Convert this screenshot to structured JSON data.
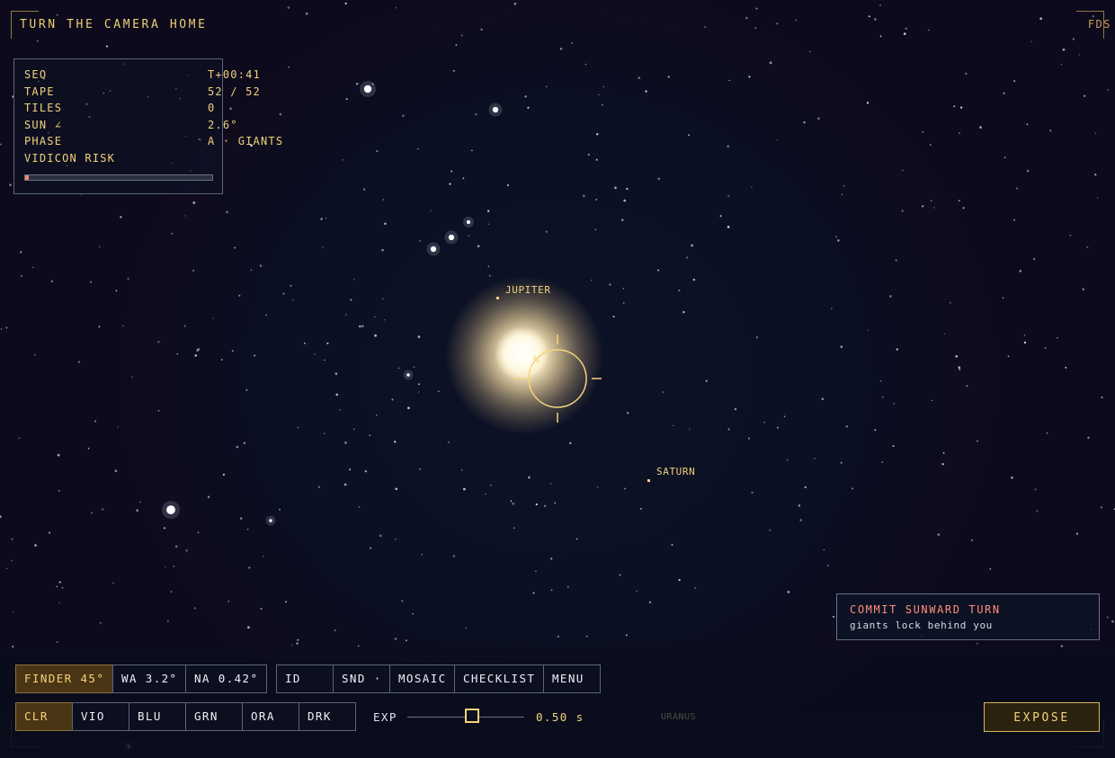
{
  "mission": {
    "title": "TURN THE CAMERA HOME",
    "fds_label": "FDS"
  },
  "status": {
    "seq_label": "SEQ",
    "seq_value": "T+00:41",
    "tape_label": "TAPE",
    "tape_value": "52 / 52",
    "tiles_label": "TILES",
    "tiles_value": "0",
    "sun_label": "SUN ∠",
    "sun_value": "2.6°",
    "phase_label": "PHASE",
    "phase_value": "A · GIANTS",
    "risk_label": "VIDICON RISK",
    "risk_fraction": 0.02
  },
  "targets": {
    "jupiter": "JUPITER",
    "saturn": "SATURN",
    "uranus": "URANUS"
  },
  "alert": {
    "title": "COMMIT SUNWARD TURN",
    "subtitle": "giants lock behind you"
  },
  "camera_modes": [
    {
      "label": "FINDER 45°",
      "active": true
    },
    {
      "label": "WA 3.2°",
      "active": false
    },
    {
      "label": "NA 0.42°",
      "active": false
    }
  ],
  "tools": [
    {
      "label": "ID"
    },
    {
      "label": "SND ·"
    },
    {
      "label": "MOSAIC"
    },
    {
      "label": "CHECKLIST"
    },
    {
      "label": "MENU"
    }
  ],
  "filters": [
    {
      "label": "CLR",
      "active": true
    },
    {
      "label": "VIO",
      "active": false
    },
    {
      "label": "BLU",
      "active": false
    },
    {
      "label": "GRN",
      "active": false
    },
    {
      "label": "ORA",
      "active": false
    },
    {
      "label": "DRK",
      "active": false
    }
  ],
  "exposure": {
    "label": "EXP",
    "value_text": "0.50 s",
    "fraction": 0.55
  },
  "expose_label": "EXPOSE",
  "colors": {
    "accent": "#f6d37a",
    "alert": "#ff8f78",
    "active_bg": "#4a3515",
    "sky": "#0b1023"
  }
}
